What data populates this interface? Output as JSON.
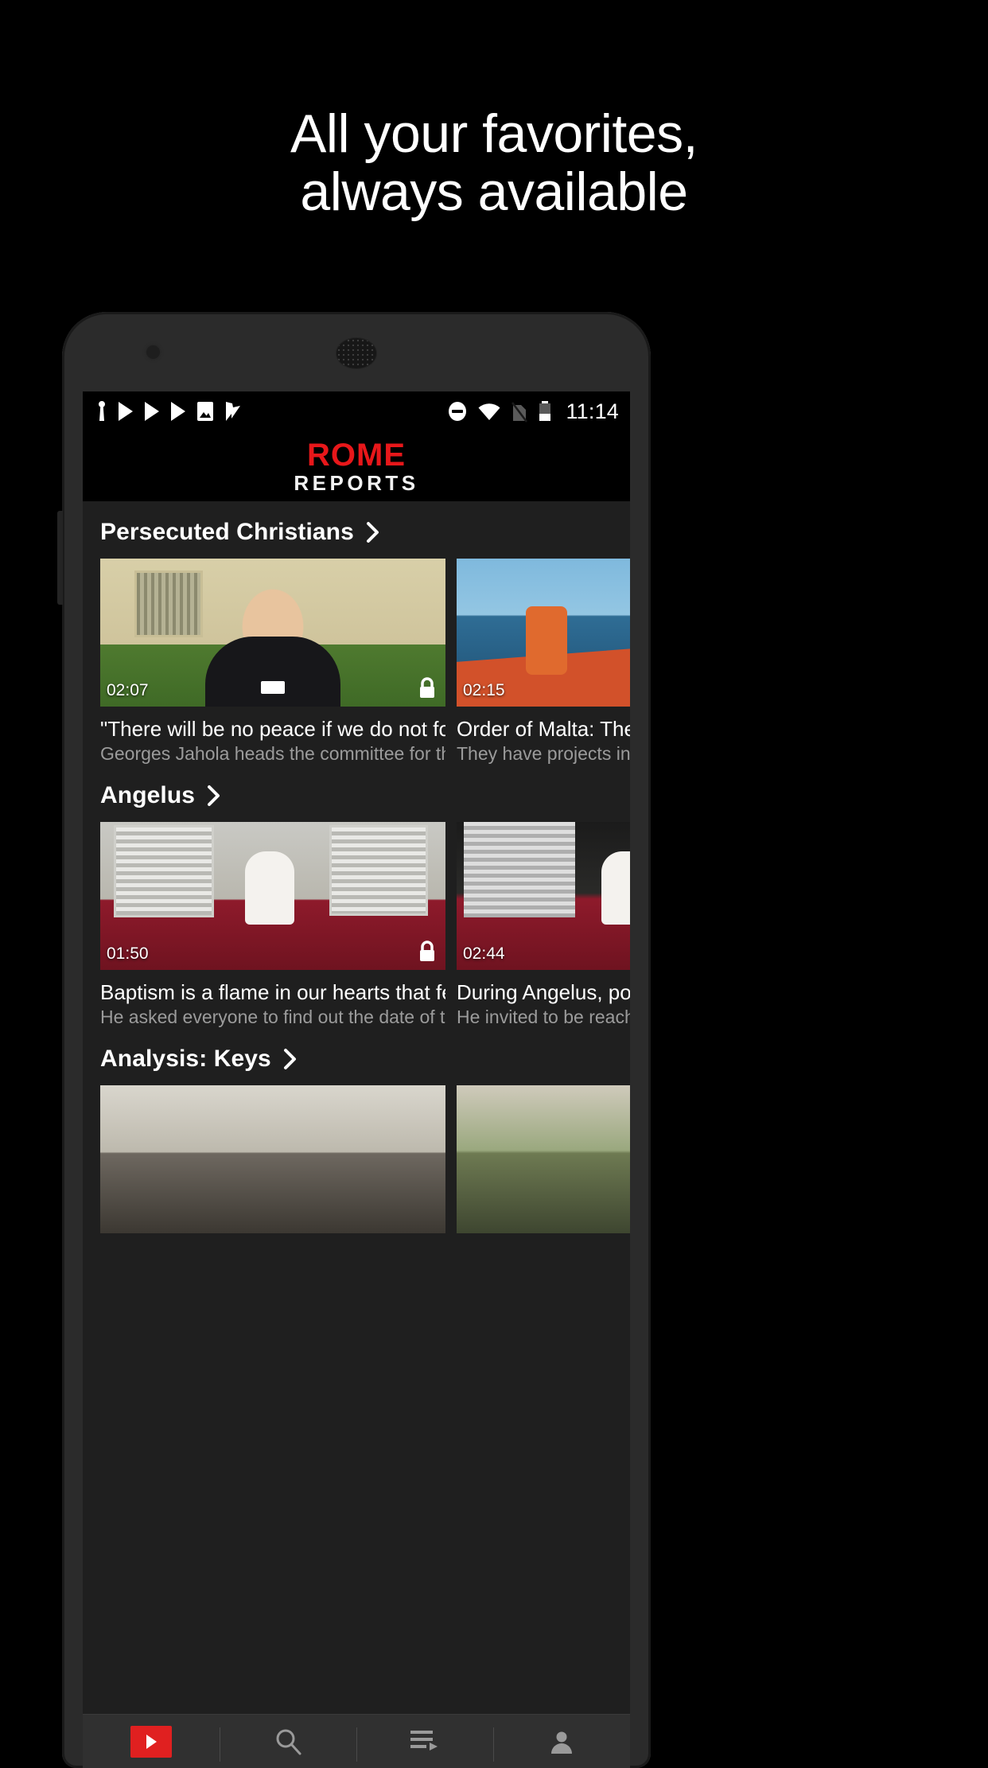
{
  "promo": {
    "line1": "All your favorites,",
    "line2": "always available"
  },
  "statusbar": {
    "time": "11:14",
    "left_icons": [
      "usb-icon",
      "play-icon",
      "play-icon",
      "play-icon",
      "image-icon",
      "check-flag-icon"
    ],
    "right_icons": [
      "do-not-disturb-icon",
      "wifi-icon",
      "no-sim-icon",
      "battery-icon"
    ]
  },
  "appbar": {
    "logo_primary": "ROME",
    "logo_secondary": "REPORTS"
  },
  "sections": [
    {
      "title": "Persecuted Christians",
      "chevron": "chevron-right-icon",
      "cards": [
        {
          "duration": "02:07",
          "locked": true,
          "title": "\"There will be no peace if we do not forgi…",
          "subtitle": "Georges Jahola heads the committee for the re…"
        },
        {
          "duration": "02:15",
          "locked": false,
          "title": "Order of Malta: The",
          "subtitle": "They have projects in Ir"
        }
      ]
    },
    {
      "title": "Angelus",
      "chevron": "chevron-right-icon",
      "cards": [
        {
          "duration": "01:50",
          "locked": true,
          "title": "Baptism is a flame in our hearts that fee…",
          "subtitle": "He asked everyone to find out the date of their o…"
        },
        {
          "duration": "02:44",
          "locked": false,
          "title": "During Angelus, pop",
          "subtitle": "He invited to be reache"
        }
      ]
    },
    {
      "title": "Analysis: Keys",
      "chevron": "chevron-right-icon",
      "cards": [
        {
          "duration": "",
          "locked": false,
          "title": "",
          "subtitle": ""
        },
        {
          "duration": "",
          "locked": false,
          "title": "",
          "subtitle": ""
        }
      ]
    }
  ],
  "bottomnav": {
    "items": [
      {
        "icon": "home-play-icon",
        "active": true
      },
      {
        "icon": "search-icon",
        "active": false
      },
      {
        "icon": "playlist-icon",
        "active": false
      },
      {
        "icon": "account-icon",
        "active": false
      }
    ]
  },
  "colors": {
    "brand_red": "#e8171a",
    "nav_active_red": "#e02020",
    "screen_bg": "#1f1f1f",
    "appbar_bg": "#000000",
    "title_text": "#ffffff",
    "subtitle_text": "#9b9b9b"
  }
}
